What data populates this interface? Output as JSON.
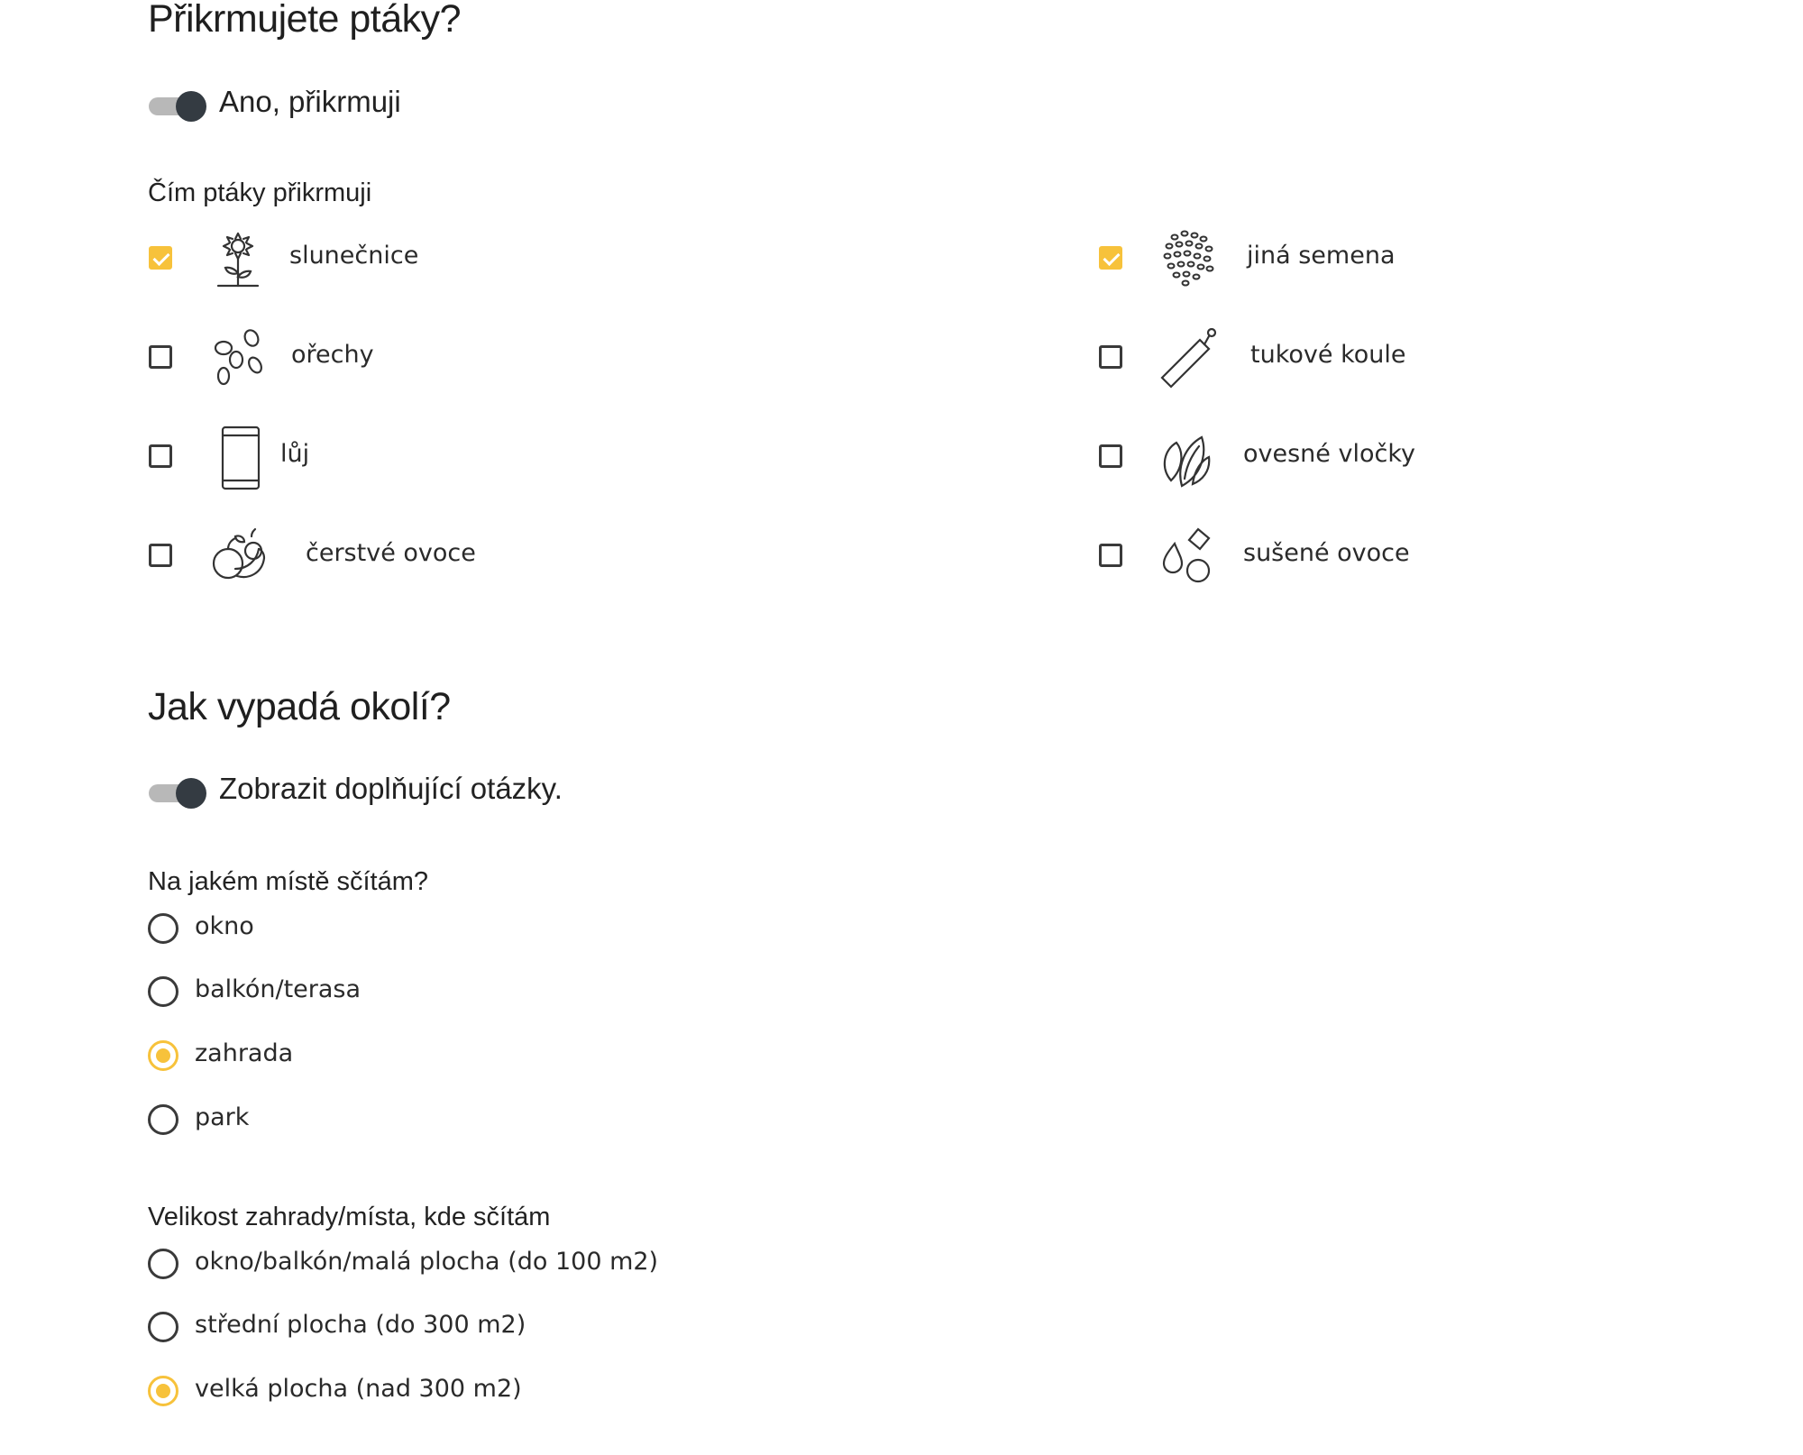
{
  "feeding": {
    "title": "Přikrmujete ptáky?",
    "toggle_label": "Ano, přikrmuji",
    "toggle_on": true,
    "question": "Čím ptáky přikrmuji",
    "options": [
      {
        "label": "slunečnice",
        "icon": "sunflower-icon",
        "checked": true
      },
      {
        "label": "ořechy",
        "icon": "nuts-icon",
        "checked": false
      },
      {
        "label": "lůj",
        "icon": "suet-icon",
        "checked": false
      },
      {
        "label": "čerstvé ovoce",
        "icon": "fresh-fruit-icon",
        "checked": false
      },
      {
        "label": "jiná semena",
        "icon": "seeds-icon",
        "checked": true
      },
      {
        "label": "tukové koule",
        "icon": "fat-ball-icon",
        "checked": false
      },
      {
        "label": "ovesné vločky",
        "icon": "oat-flakes-icon",
        "checked": false
      },
      {
        "label": "sušené ovoce",
        "icon": "dried-fruit-icon",
        "checked": false
      }
    ]
  },
  "surroundings": {
    "title": "Jak vypadá okolí?",
    "toggle_label": "Zobrazit doplňující otázky.",
    "toggle_on": true,
    "place": {
      "question": "Na jakém místě sčítám?",
      "options": [
        "okno",
        "balkón/terasa",
        "zahrada",
        "park"
      ],
      "selected": "zahrada"
    },
    "size": {
      "question": "Velikost zahrady/místa, kde sčítám",
      "options": [
        "okno/balkón/malá plocha (do 100 m2)",
        "střední plocha (do 300 m2)",
        "velká plocha (nad 300 m2)"
      ],
      "selected": "velká plocha (nad 300 m2)"
    }
  },
  "colors": {
    "accent": "#f7c23b",
    "toggle_knob": "#343b42",
    "toggle_track": "#b8b8b8",
    "text": "#222222"
  }
}
